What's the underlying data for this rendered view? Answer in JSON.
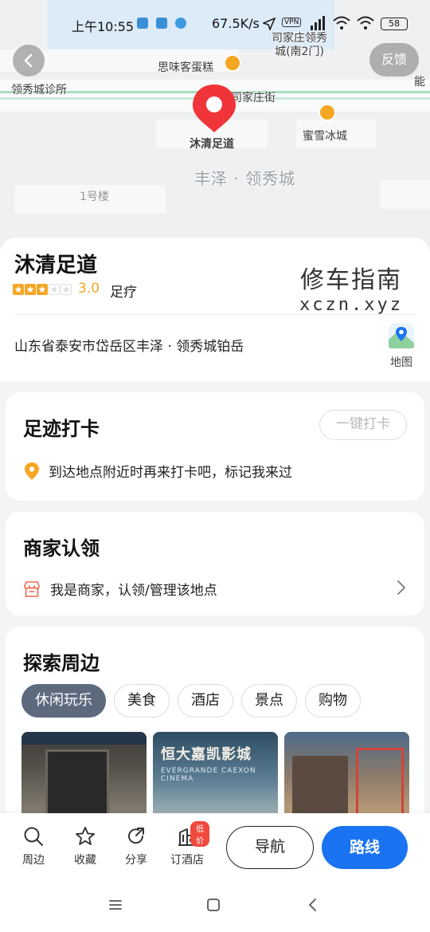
{
  "status_bar": {
    "time": "上午10:55",
    "net_speed": "67.5K/s",
    "vpn": "VPN",
    "battery": "58"
  },
  "map": {
    "labels": {
      "clinic": "领秀城诊所",
      "cake": "思味客蛋糕",
      "gate": "司家庄领秀城(南2门)",
      "street": "司家庄街",
      "icecream": "蜜雪冰城",
      "edge_right": "能",
      "selected": "沐清足道",
      "district": "丰泽 · 领秀城",
      "building": "1号楼"
    },
    "feedback": "反馈"
  },
  "place": {
    "name": "沐清足道",
    "stars": 3,
    "score": "3.0",
    "category": "足疗",
    "address": "山东省泰安市岱岳区丰泽 · 领秀城铂岳",
    "map_label": "地图"
  },
  "watermark": {
    "line1": "修车指南",
    "line2": "xczn.xyz"
  },
  "checkin": {
    "title": "足迹打卡",
    "button": "一键打卡",
    "hint": "到达地点附近时再来打卡吧，标记我来过"
  },
  "merchant": {
    "title": "商家认领",
    "text": "我是商家，认领/管理该地点"
  },
  "explore": {
    "title": "探索周边",
    "chips": [
      "休闲玩乐",
      "美食",
      "酒店",
      "景点",
      "购物"
    ],
    "active_chip": 0,
    "photo2_text": "恒大嘉凯影城",
    "photo2_sub": "EVERGRANDE CAEXON CINEMA"
  },
  "bottom_bar": {
    "tabs": [
      {
        "label": "周边",
        "icon": "search-icon"
      },
      {
        "label": "收藏",
        "icon": "star-icon"
      },
      {
        "label": "分享",
        "icon": "share-icon"
      },
      {
        "label": "订酒店",
        "icon": "hotel-icon",
        "badge": "低价"
      }
    ],
    "navigate": "导航",
    "route": "路线"
  },
  "colors": {
    "accent_blue": "#1a73f0",
    "pin_red": "#f0353a",
    "star_orange": "#f5a623",
    "chip_active": "#5d6a7e"
  }
}
